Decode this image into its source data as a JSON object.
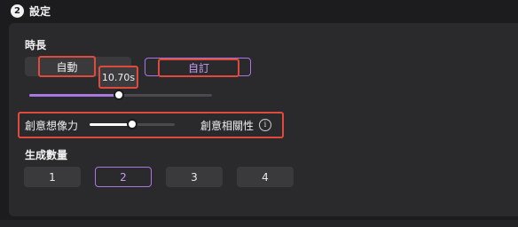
{
  "header": {
    "step_number": "2",
    "title": "設定"
  },
  "duration": {
    "label": "時長",
    "tabs": [
      {
        "label": "自動",
        "selected": false
      },
      {
        "label": "自訂",
        "selected": true
      }
    ],
    "tooltip": "10.70s",
    "slider_fraction": 0.49
  },
  "creativity": {
    "label": "創意想像力",
    "right_label": "創意相關性",
    "info_icon": "info-icon",
    "slider_fraction": 0.5
  },
  "count": {
    "label": "生成數量",
    "options": [
      "1",
      "2",
      "3",
      "4"
    ],
    "selected_index": 1
  },
  "colors": {
    "accent": "#a977e0",
    "highlight_box": "#e04a3c",
    "panel": "#2a2a2d"
  }
}
